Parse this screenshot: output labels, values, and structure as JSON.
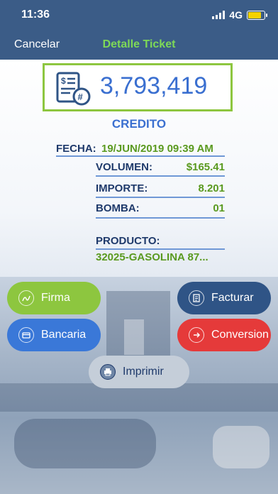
{
  "status": {
    "time": "11:36",
    "network": "4G"
  },
  "nav": {
    "cancel_label": "Cancelar",
    "title": "Detalle Ticket"
  },
  "ticket": {
    "number": "3,793,419"
  },
  "payment_type": "CREDITO",
  "details": {
    "fecha_label": "FECHA:",
    "fecha_value": "19/JUN/2019 09:39 AM",
    "volumen_label": "VOLUMEN:",
    "volumen_value": "$165.41",
    "importe_label": "IMPORTE:",
    "importe_value": "8.201",
    "bomba_label": "BOMBA:",
    "bomba_value": "01",
    "producto_label": "PRODUCTO:",
    "producto_value": "32025-GASOLINA 87..."
  },
  "buttons": {
    "firma": "Firma",
    "facturar": "Facturar",
    "bancaria": "Bancaria",
    "conversion": "Conversion",
    "imprimir": "Imprimir"
  },
  "colors": {
    "header": "#3b5c87",
    "accent_green": "#8dc63f",
    "accent_blue": "#3a6fd0",
    "value_green": "#5a9a1f",
    "label_navy": "#1f3a6b",
    "danger_red": "#e53a3a"
  },
  "battery_level": 0.75
}
